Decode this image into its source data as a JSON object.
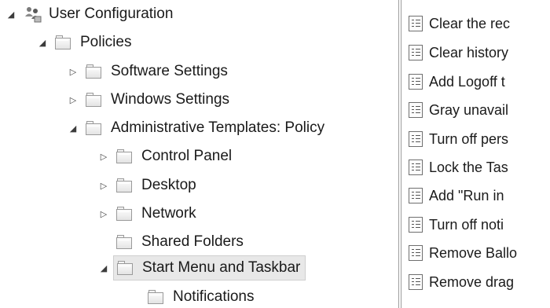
{
  "tree": {
    "root": {
      "label": "User Configuration",
      "icon": "users-config-icon",
      "expanded": true
    },
    "nodes": [
      {
        "label": "Policies",
        "state": "expanded"
      },
      {
        "label": "Software Settings",
        "state": "collapsed"
      },
      {
        "label": "Windows Settings",
        "state": "collapsed"
      },
      {
        "label": "Administrative Templates: Policy",
        "state": "expanded"
      },
      {
        "label": "Control Panel",
        "state": "collapsed"
      },
      {
        "label": "Desktop",
        "state": "collapsed"
      },
      {
        "label": "Network",
        "state": "collapsed"
      },
      {
        "label": "Shared Folders",
        "state": "none"
      },
      {
        "label": "Start Menu and Taskbar",
        "state": "expanded",
        "selected": true
      },
      {
        "label": "Notifications",
        "state": "none"
      }
    ],
    "glyphs": {
      "expanded": "◢",
      "collapsed": "▷"
    }
  },
  "settings": {
    "items": [
      "Clear the rec",
      "Clear history",
      "Add Logoff t",
      "Gray unavail",
      "Turn off pers",
      "Lock the Tas",
      "Add \"Run in",
      "Turn off noti",
      "Remove Ballo",
      "Remove drag"
    ]
  },
  "colors": {
    "selected_bg": "#e8e8e8",
    "divider": "#9c9c9c"
  }
}
